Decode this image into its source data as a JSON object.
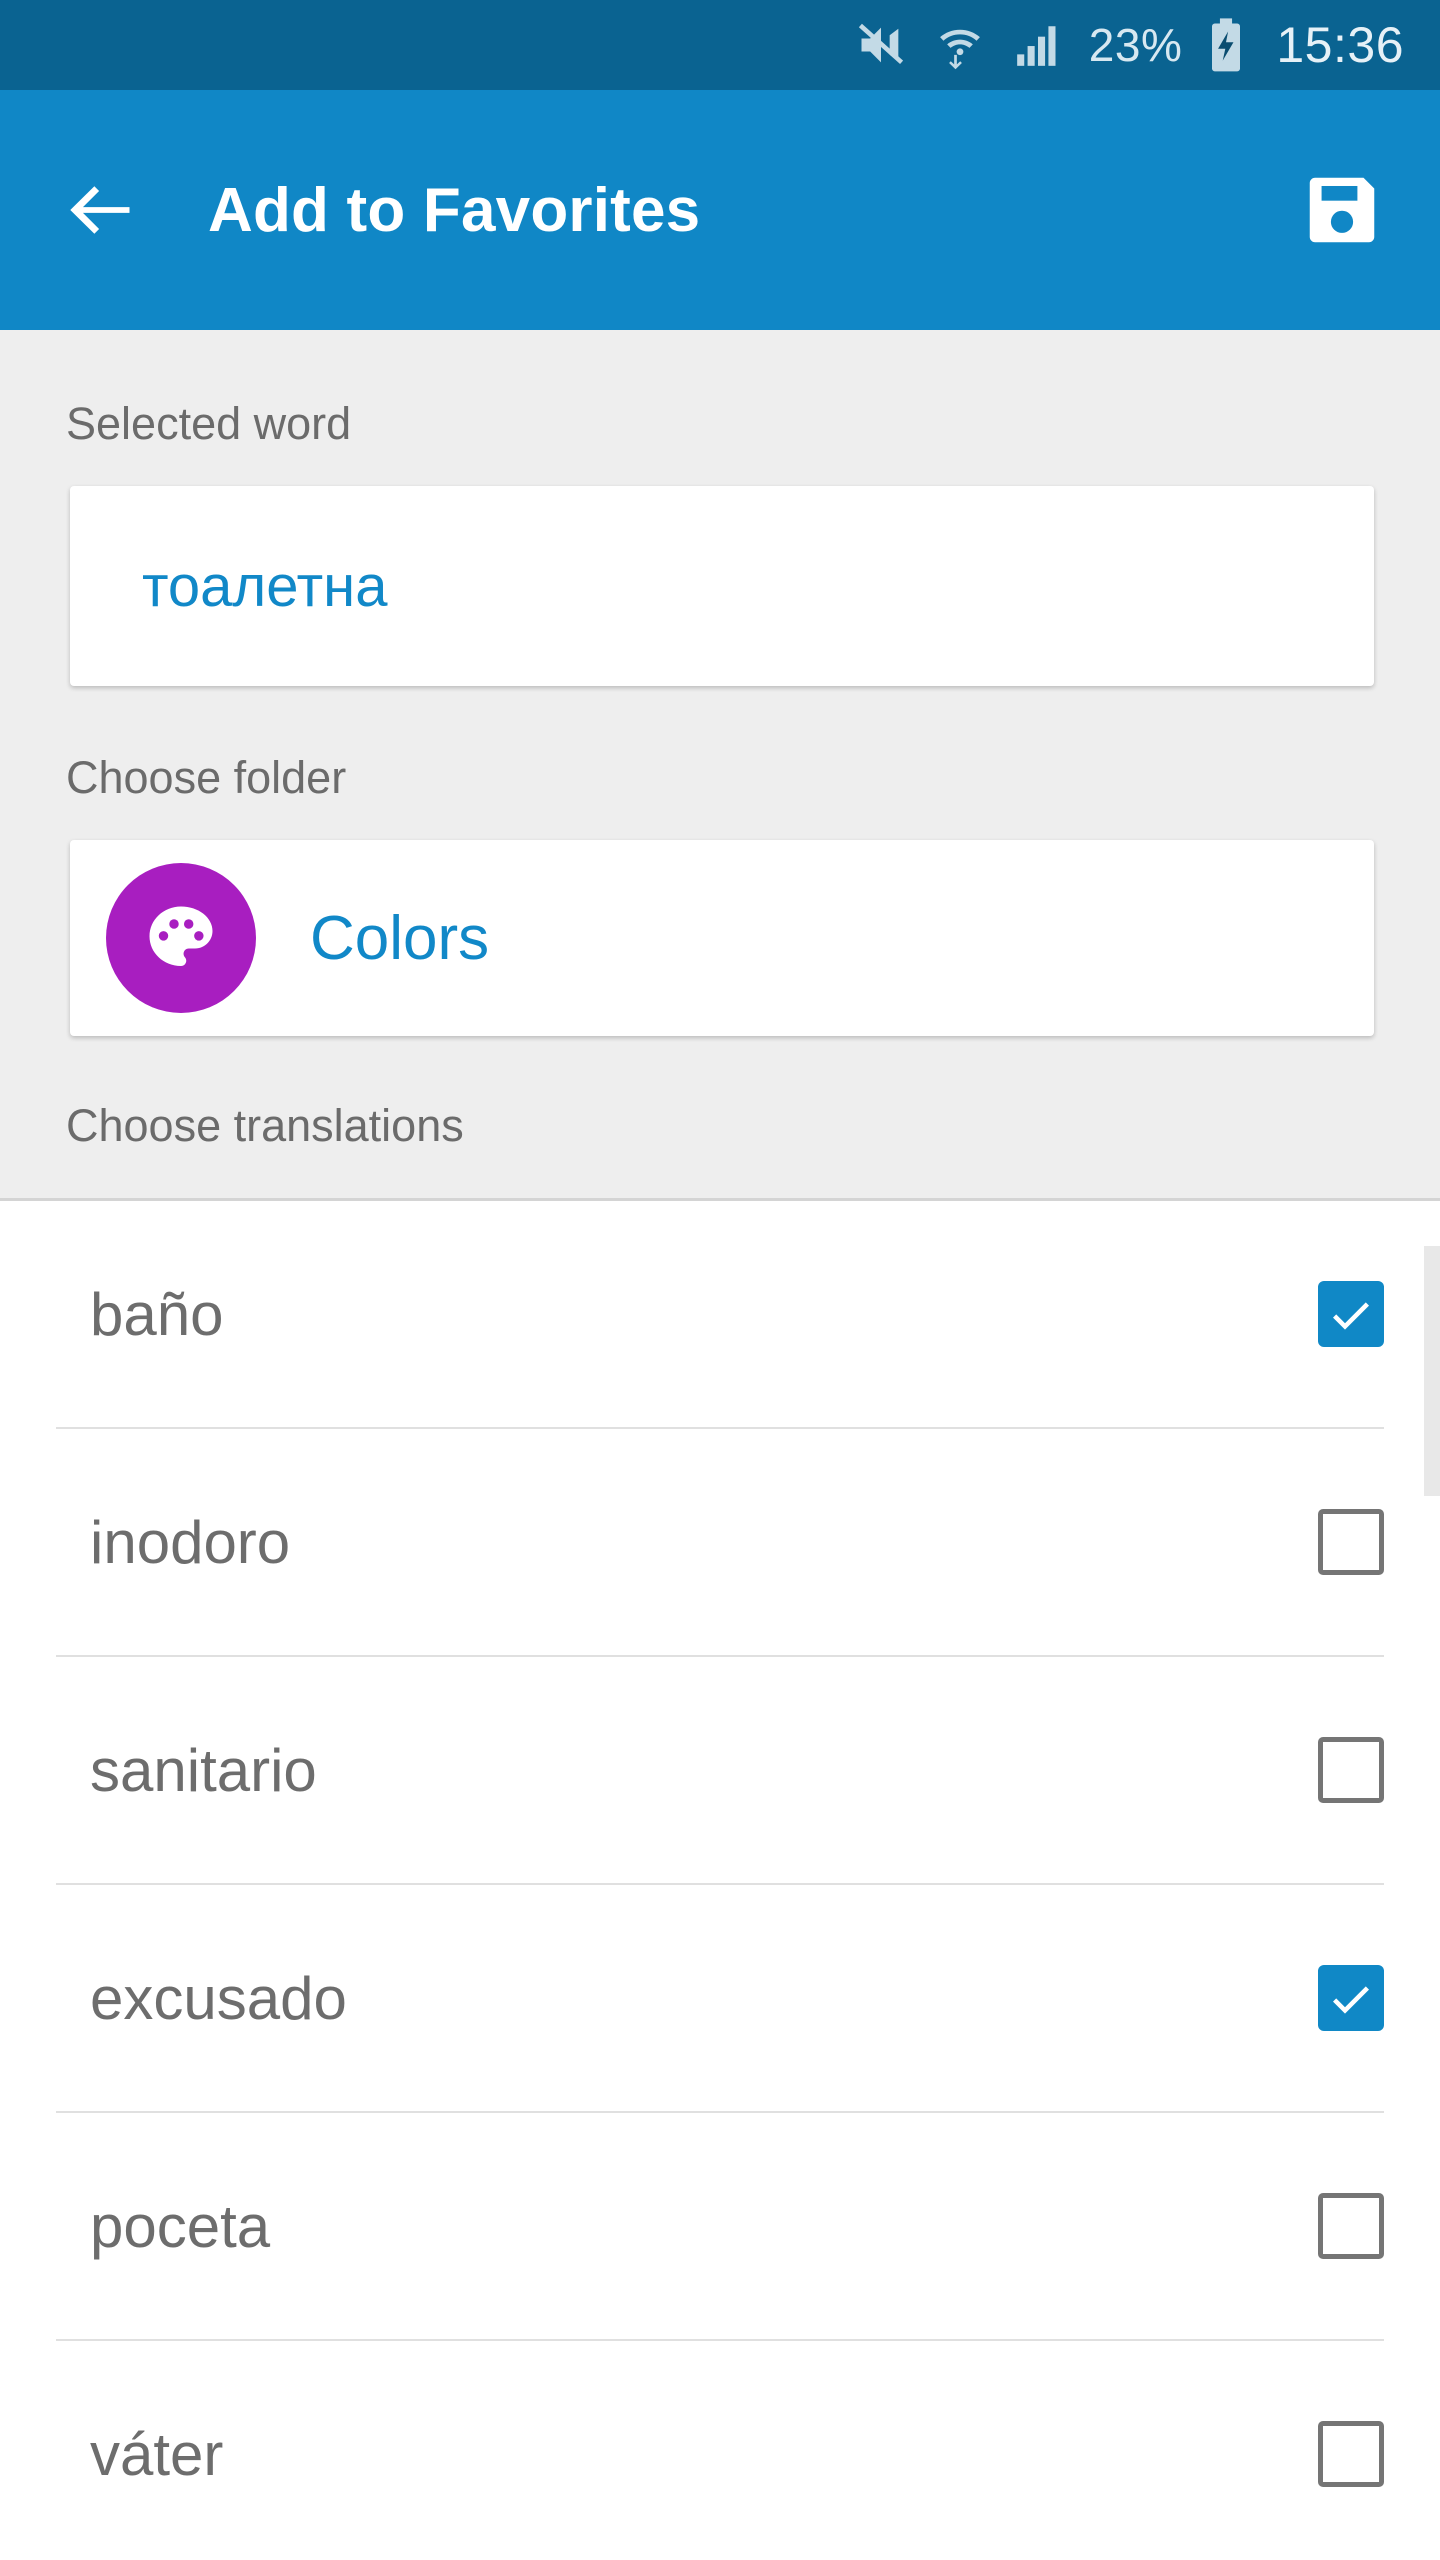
{
  "status_bar": {
    "mute_icon": "volume-mute-icon",
    "wifi_icon": "wifi-transfer-icon",
    "signal_icon": "cellular-signal-icon",
    "battery_percent": "23%",
    "battery_icon": "battery-charging-icon",
    "clock": "15:36",
    "background": "#0a6391"
  },
  "app_bar": {
    "back_icon": "arrow-left-icon",
    "title": "Add to Favorites",
    "save_icon": "floppy-disk-save-icon",
    "background": "#1087c6"
  },
  "selected_word": {
    "label": "Selected word",
    "value": "тоалетна",
    "value_color": "#1188c8"
  },
  "choose_folder": {
    "label": "Choose folder",
    "folder_name": "Colors",
    "folder_icon": "palette-icon",
    "avatar_color": "#a81ec0",
    "name_color": "#1188c8"
  },
  "choose_translations": {
    "label": "Choose translations",
    "checkbox_checked_color": "#1088c6",
    "checkbox_unchecked_color": "#757575",
    "items": [
      {
        "label": "baño",
        "checked": true
      },
      {
        "label": "inodoro",
        "checked": false
      },
      {
        "label": "sanitario",
        "checked": false
      },
      {
        "label": "excusado",
        "checked": true
      },
      {
        "label": "poceta",
        "checked": false
      },
      {
        "label": "váter",
        "checked": false
      }
    ]
  },
  "scrollbar": {
    "visible": true
  }
}
